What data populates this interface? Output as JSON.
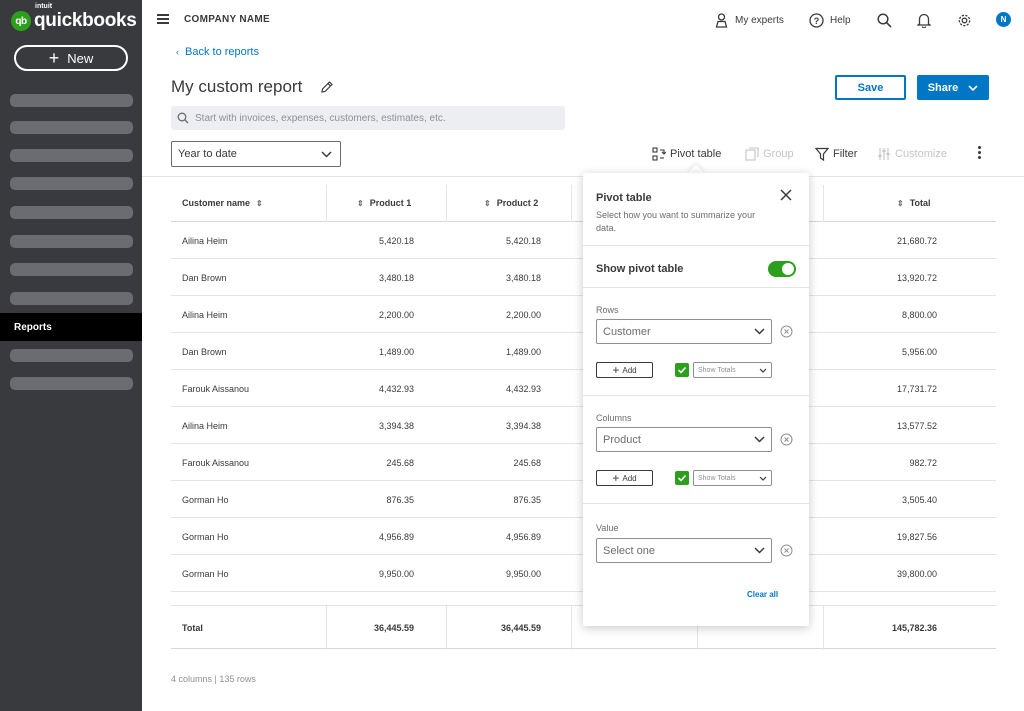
{
  "brand": {
    "intuit": "intuit",
    "word": "quickbooks",
    "mark": "qb",
    "green": "#2ca01c",
    "blue": "#0077c5"
  },
  "sidebar": {
    "new_label": "New",
    "active_item": "Reports"
  },
  "topbar": {
    "company": "COMPANY NAME",
    "my_experts": "My experts",
    "help": "Help",
    "avatar_initial": "N"
  },
  "page": {
    "back": "Back to reports",
    "title": "My custom report",
    "save": "Save",
    "share": "Share",
    "search_placeholder": "Start with invoices, expenses, customers, estimates, etc.",
    "date_range": "Year to date"
  },
  "toolbar": {
    "pivot": "Pivot table",
    "group": "Group",
    "filter": "Filter",
    "customize": "Customize"
  },
  "table": {
    "headers": [
      "Customer name",
      "Product 1",
      "Product 2",
      "",
      "",
      "Total"
    ],
    "rows": [
      {
        "name": "Ailina Heim",
        "p1": "5,420.18",
        "p2": "5,420.18",
        "total": "21,680.72"
      },
      {
        "name": "Dan Brown",
        "p1": "3,480.18",
        "p2": "3,480.18",
        "total": "13,920.72"
      },
      {
        "name": "Ailina Heim",
        "p1": "2,200.00",
        "p2": "2,200.00",
        "total": "8,800.00"
      },
      {
        "name": "Dan Brown",
        "p1": "1,489.00",
        "p2": "1,489.00",
        "total": "5,956.00"
      },
      {
        "name": "Farouk Aissanou",
        "p1": "4,432.93",
        "p2": "4,432.93",
        "total": "17,731.72"
      },
      {
        "name": "Ailina Heim",
        "p1": "3,394.38",
        "p2": "3,394.38",
        "total": "13,577.52"
      },
      {
        "name": "Farouk Aissanou",
        "p1": "245.68",
        "p2": "245.68",
        "total": "982.72"
      },
      {
        "name": "Gorman Ho",
        "p1": "876.35",
        "p2": "876.35",
        "total": "3,505.40"
      },
      {
        "name": "Gorman Ho",
        "p1": "4,956.89",
        "p2": "4,956.89",
        "total": "19,827.56"
      },
      {
        "name": "Gorman Ho",
        "p1": "9,950.00",
        "p2": "9,950.00",
        "total": "39,800.00"
      }
    ],
    "total_row": {
      "name": "Total",
      "p1": "36,445.59",
      "p2": "36,445.59",
      "total": "145,782.36"
    },
    "meta": "4 columns | 135 rows"
  },
  "pivot": {
    "title": "Pivot table",
    "description": "Select how you want to summarize your data.",
    "toggle_label": "Show pivot table",
    "toggle_on": true,
    "rows_label": "Rows",
    "rows_value": "Customer",
    "columns_label": "Columns",
    "columns_value": "Product",
    "value_label": "Value",
    "value_placeholder": "Select one",
    "add_label": "Add",
    "show_totals": "Show Totals",
    "clear_all": "Clear all"
  }
}
